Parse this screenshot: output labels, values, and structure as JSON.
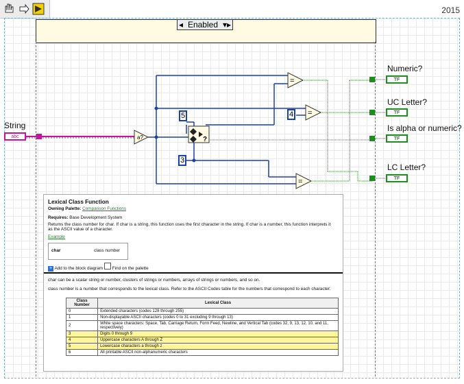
{
  "year": "2015",
  "case_selector": "Enabled",
  "indicators": [
    "Numeric?",
    "UC Letter?",
    "Is alpha or numeric?",
    "LC Letter?"
  ],
  "controls": {
    "string_label": "String",
    "string_icon": "abc"
  },
  "terminal_text": "TF",
  "constants": {
    "five": "5",
    "four": "4",
    "three": "3"
  },
  "help": {
    "title": "Lexical Class Function",
    "owning_label": "Owning Palette:",
    "owning_link": "Comparison Functions",
    "requires_label": "Requires:",
    "requires_value": "Base Development System",
    "desc": "Returns the class number for char. If char is a string, this function uses the first character in the string. If char is a number, this function interprets it as the ASCII value of a character.",
    "example": "Example",
    "char_label": "char",
    "class_label": "class number",
    "add_to_diagram": "Add to the block diagram",
    "find_palette": "Find on the palette",
    "char_desc": "char can be a scalar string or number, clusters of strings or numbers, arrays of strings or numbers, and so on.",
    "class_desc": "class number is a number that corresponds to the lexical class. Refer to the ASCII Codes table for the numbers that correspond to each character.",
    "table_header": [
      "Class Number",
      "Lexical Class"
    ],
    "table_rows": [
      [
        "0",
        "Extended characters (codes 128 through 255)"
      ],
      [
        "1",
        "Non-displayable ASCII characters (codes 0 to 31 excluding 9 through 13)"
      ],
      [
        "2",
        "White space characters: Space, Tab, Carriage Return, Form Feed, Newline, and Vertical Tab (codes 32, 9, 13, 12, 10, and 11, respectively)"
      ],
      [
        "3",
        "Digits 0 through 9"
      ],
      [
        "4",
        "Uppercase characters A through Z"
      ],
      [
        "5",
        "Lowercase characters a through z"
      ],
      [
        "6",
        "All printable ASCII non-alphanumeric characters"
      ]
    ]
  },
  "colors": {
    "bool_wire": "#1e8c1e",
    "string_wire": "#c0179a",
    "number_wire": "#1d3fa8",
    "highlight": "#fff59d"
  }
}
